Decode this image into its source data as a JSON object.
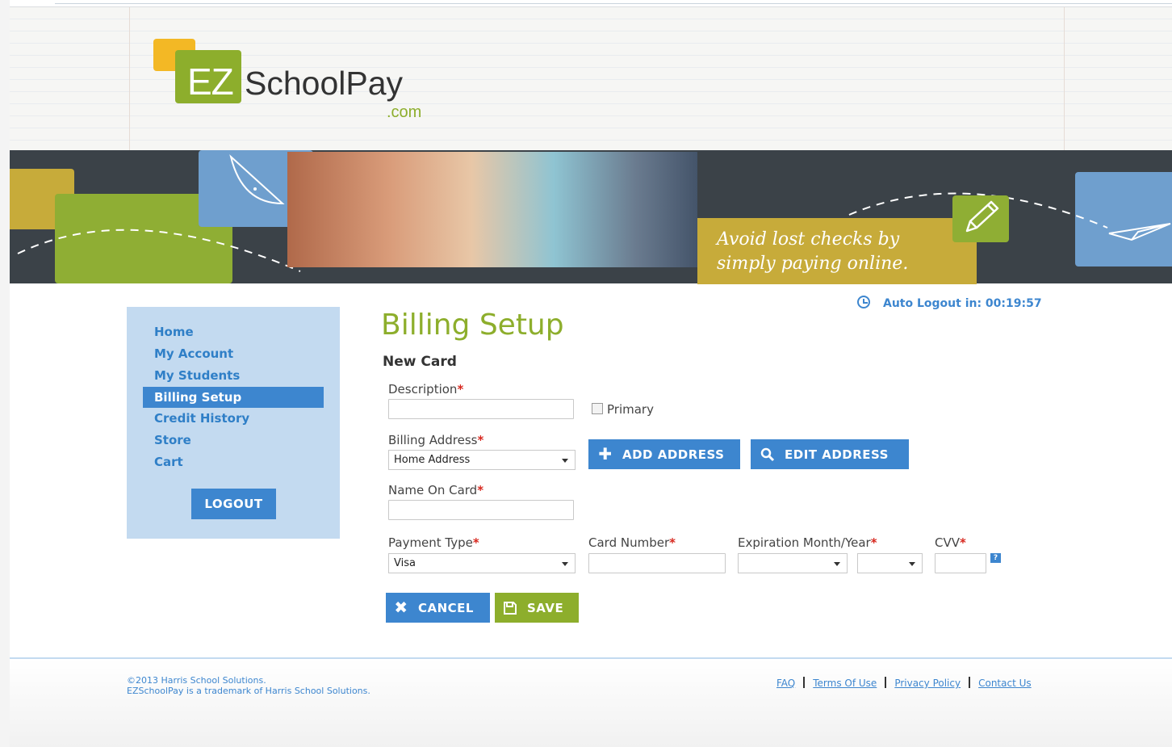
{
  "brand": {
    "logo_ez": "EZ",
    "logo_school": "SchoolPay",
    "logo_com": ".com",
    "primary_color": "#8dae2c",
    "accent_color": "#3d86cf",
    "highlight_color": "#f3b825"
  },
  "banner": {
    "tagline_line1": "Avoid lost checks by",
    "tagline_line2": "simply paying online."
  },
  "sidebar": {
    "items": [
      {
        "label": "Home"
      },
      {
        "label": "My Account"
      },
      {
        "label": "My Students"
      },
      {
        "label": "Billing Setup",
        "active": true
      },
      {
        "label": "Credit History"
      },
      {
        "label": "Store"
      },
      {
        "label": "Cart"
      }
    ],
    "logout_label": "LOGOUT"
  },
  "main": {
    "title": "Billing Setup",
    "section_title": "New Card",
    "auto_logout": "Auto Logout in: 00:19:57",
    "form": {
      "description_label": "Description",
      "description_value": "",
      "primary_label": "Primary",
      "primary_checked": false,
      "billing_address_label": "Billing Address",
      "billing_address_value": "Home Address",
      "add_address_label": "ADD ADDRESS",
      "edit_address_label": "EDIT ADDRESS",
      "name_on_card_label": "Name On Card",
      "name_on_card_value": "",
      "payment_type_label": "Payment Type",
      "payment_type_value": "Visa",
      "card_number_label": "Card Number",
      "card_number_value": "",
      "expiration_label": "Expiration Month/Year",
      "expiration_month_value": "",
      "expiration_year_value": "",
      "cvv_label": "CVV",
      "cvv_value": "",
      "help_label": "?",
      "required_marker": "*",
      "cancel_label": "CANCEL",
      "save_label": "SAVE"
    }
  },
  "footer": {
    "copyright_line1": "©2013 Harris School Solutions.",
    "copyright_line2": "EZSchoolPay is a trademark of Harris School Solutions.",
    "links": [
      {
        "label": "FAQ"
      },
      {
        "label": "Terms Of Use"
      },
      {
        "label": "Privacy Policy"
      },
      {
        "label": "Contact Us"
      }
    ]
  }
}
